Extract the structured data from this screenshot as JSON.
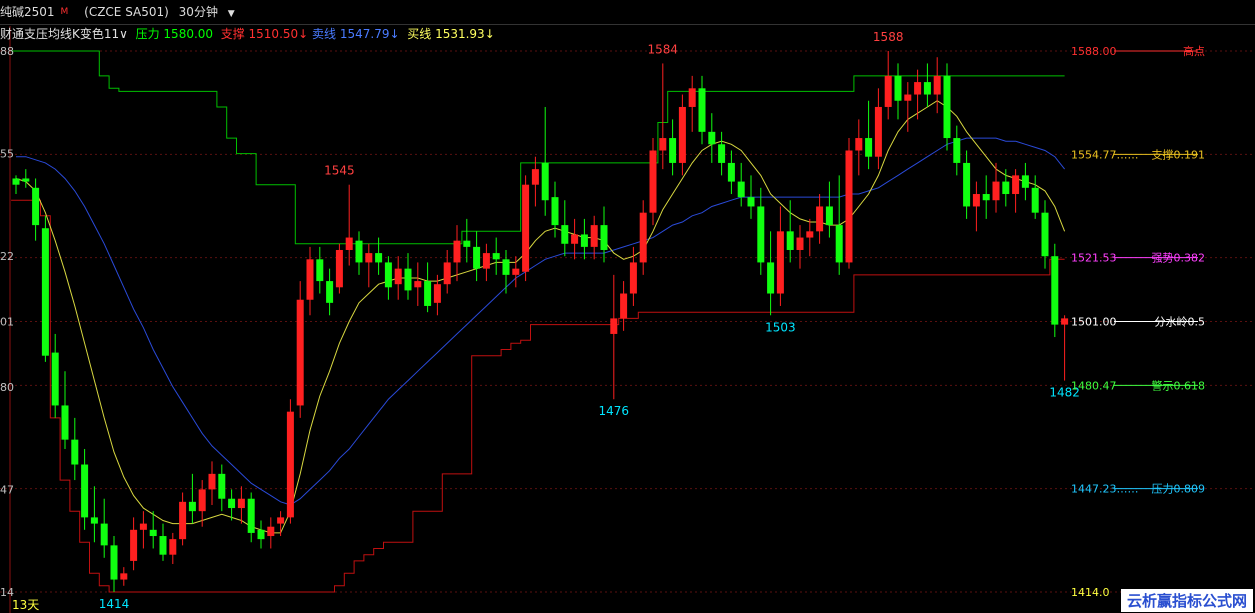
{
  "header": {
    "symbol": "纯碱2501",
    "marker": "M",
    "contract": "(CZCE SA501)",
    "period": "30分钟"
  },
  "indicator": {
    "name": "财通支压均线K变色11",
    "arrow": "∨",
    "resistance_label": "压力",
    "resistance_value": "1580.00",
    "support_label": "支撑",
    "support_value": "1510.50",
    "support_arrow": "↓",
    "sell_label": "卖线",
    "sell_value": "1547.79",
    "sell_arrow": "↓",
    "buy_label": "买线",
    "buy_value": "1531.93",
    "buy_arrow": "↓",
    "colors": {
      "name": "#e0e0e0",
      "resistance": "#00ff00",
      "support": "#ff3030",
      "sell": "#4a7bff",
      "buy": "#ffff60"
    }
  },
  "days_label": "13天",
  "watermark": "云析赢指标公式网",
  "chart_data": {
    "type": "candlestick",
    "y_axis_ticks": [
      {
        "value": 1588,
        "label": "88"
      },
      {
        "value": 1555,
        "label": "55"
      },
      {
        "value": 1522,
        "label": "22"
      },
      {
        "value": 1501,
        "label": "01"
      },
      {
        "value": 1480,
        "label": "80"
      },
      {
        "value": 1447,
        "label": "47"
      },
      {
        "value": 1414,
        "label": "14"
      }
    ],
    "ylim": [
      1411,
      1592
    ],
    "extreme_labels": [
      {
        "text": "1545",
        "value": 1545,
        "index": 33,
        "side": "high",
        "color": "#ff4040"
      },
      {
        "text": "1584",
        "value": 1584,
        "index": 66,
        "side": "high",
        "color": "#ff4040"
      },
      {
        "text": "1588",
        "value": 1588,
        "index": 89,
        "side": "high",
        "color": "#ff4040"
      },
      {
        "text": "1414",
        "value": 1414,
        "index": 10,
        "side": "low",
        "color": "#00e5ff"
      },
      {
        "text": "1476",
        "value": 1476,
        "index": 61,
        "side": "low",
        "color": "#00e5ff"
      },
      {
        "text": "1503",
        "value": 1503,
        "index": 78,
        "side": "low",
        "color": "#00e5ff"
      },
      {
        "text": "1482",
        "value": 1482,
        "index": 107,
        "side": "low",
        "color": "#00e5ff"
      }
    ],
    "levels": [
      {
        "value": 1588,
        "value_text": "1588.00",
        "name": "高点",
        "color": "#ff3030"
      },
      {
        "value": 1554.77,
        "value_text": "1554.77……",
        "name": "支撑0.191",
        "color": "#e8c020"
      },
      {
        "value": 1521.53,
        "value_text": "1521.53",
        "name": "强势0.382",
        "color": "#ff40ff"
      },
      {
        "value": 1501,
        "value_text": "1501.00",
        "name": "分水岭0.5",
        "color": "#ffffff"
      },
      {
        "value": 1480.47,
        "value_text": "1480.47",
        "name": "警示0.618",
        "color": "#40ff40"
      },
      {
        "value": 1447.23,
        "value_text": "1447.23……",
        "name": "压力0.809",
        "color": "#20c8ff"
      },
      {
        "value": 1414,
        "value_text": "1414.0",
        "name": "",
        "color": "#ffff40"
      }
    ],
    "candles": [
      [
        1547,
        1548,
        1542,
        1545
      ],
      [
        1547,
        1550,
        1544,
        1546
      ],
      [
        1544,
        1547,
        1527,
        1532
      ],
      [
        1531,
        1535,
        1488,
        1490
      ],
      [
        1491,
        1497,
        1470,
        1474
      ],
      [
        1474,
        1485,
        1460,
        1463
      ],
      [
        1463,
        1470,
        1450,
        1455
      ],
      [
        1455,
        1460,
        1434,
        1438
      ],
      [
        1438,
        1448,
        1430,
        1436
      ],
      [
        1436,
        1444,
        1425,
        1429
      ],
      [
        1429,
        1432,
        1414,
        1418
      ],
      [
        1418,
        1422,
        1416,
        1420
      ],
      [
        1424,
        1438,
        1421,
        1434
      ],
      [
        1434,
        1440,
        1428,
        1436
      ],
      [
        1434,
        1440,
        1428,
        1432
      ],
      [
        1432,
        1436,
        1424,
        1426
      ],
      [
        1426,
        1433,
        1423,
        1431
      ],
      [
        1431,
        1446,
        1429,
        1443
      ],
      [
        1443,
        1452,
        1436,
        1440
      ],
      [
        1440,
        1450,
        1435,
        1447
      ],
      [
        1447,
        1456,
        1442,
        1452
      ],
      [
        1452,
        1455,
        1440,
        1444
      ],
      [
        1444,
        1447,
        1437,
        1441
      ],
      [
        1441,
        1448,
        1436,
        1444
      ],
      [
        1444,
        1446,
        1430,
        1433
      ],
      [
        1434,
        1437,
        1428,
        1431
      ],
      [
        1432,
        1438,
        1428,
        1435
      ],
      [
        1436,
        1440,
        1432,
        1438
      ],
      [
        1438,
        1476,
        1436,
        1472
      ],
      [
        1474,
        1514,
        1470,
        1508
      ],
      [
        1508,
        1525,
        1503,
        1521
      ],
      [
        1521,
        1525,
        1510,
        1514
      ],
      [
        1514,
        1518,
        1503,
        1507
      ],
      [
        1512,
        1526,
        1510,
        1524
      ],
      [
        1524,
        1545,
        1519,
        1528
      ],
      [
        1527,
        1530,
        1516,
        1520
      ],
      [
        1520,
        1526,
        1512,
        1523
      ],
      [
        1523,
        1528,
        1516,
        1520
      ],
      [
        1520,
        1522,
        1508,
        1512
      ],
      [
        1513,
        1522,
        1508,
        1518
      ],
      [
        1518,
        1523,
        1508,
        1511
      ],
      [
        1512,
        1520,
        1506,
        1514
      ],
      [
        1514,
        1520,
        1504,
        1506
      ],
      [
        1507,
        1516,
        1503,
        1513
      ],
      [
        1513,
        1524,
        1510,
        1520
      ],
      [
        1520,
        1532,
        1514,
        1527
      ],
      [
        1527,
        1534,
        1520,
        1525
      ],
      [
        1525,
        1530,
        1514,
        1518
      ],
      [
        1518,
        1526,
        1514,
        1523
      ],
      [
        1523,
        1528,
        1516,
        1521
      ],
      [
        1521,
        1524,
        1510,
        1516
      ],
      [
        1516,
        1522,
        1512,
        1518
      ],
      [
        1517,
        1548,
        1514,
        1545
      ],
      [
        1545,
        1554,
        1538,
        1550
      ],
      [
        1552,
        1570,
        1535,
        1540
      ],
      [
        1541,
        1546,
        1528,
        1532
      ],
      [
        1532,
        1540,
        1522,
        1526
      ],
      [
        1526,
        1534,
        1521,
        1529
      ],
      [
        1529,
        1534,
        1521,
        1525
      ],
      [
        1525,
        1535,
        1521,
        1532
      ],
      [
        1532,
        1538,
        1520,
        1524
      ],
      [
        1497,
        1516,
        1476,
        1502
      ],
      [
        1502,
        1514,
        1498,
        1510
      ],
      [
        1510,
        1525,
        1506,
        1520
      ],
      [
        1520,
        1540,
        1516,
        1536
      ],
      [
        1536,
        1560,
        1532,
        1556
      ],
      [
        1556,
        1584,
        1550,
        1560
      ],
      [
        1560,
        1566,
        1548,
        1552
      ],
      [
        1552,
        1574,
        1548,
        1570
      ],
      [
        1570,
        1580,
        1562,
        1576
      ],
      [
        1576,
        1580,
        1558,
        1562
      ],
      [
        1562,
        1568,
        1552,
        1558
      ],
      [
        1558,
        1562,
        1548,
        1552
      ],
      [
        1552,
        1556,
        1542,
        1546
      ],
      [
        1546,
        1552,
        1538,
        1541
      ],
      [
        1541,
        1548,
        1534,
        1538
      ],
      [
        1538,
        1544,
        1516,
        1520
      ],
      [
        1520,
        1530,
        1503,
        1510
      ],
      [
        1510,
        1538,
        1506,
        1530
      ],
      [
        1530,
        1540,
        1520,
        1524
      ],
      [
        1524,
        1532,
        1518,
        1528
      ],
      [
        1528,
        1534,
        1522,
        1530
      ],
      [
        1530,
        1542,
        1526,
        1538
      ],
      [
        1538,
        1546,
        1528,
        1532
      ],
      [
        1532,
        1548,
        1516,
        1520
      ],
      [
        1520,
        1560,
        1518,
        1556
      ],
      [
        1556,
        1566,
        1548,
        1560
      ],
      [
        1560,
        1572,
        1550,
        1554
      ],
      [
        1554,
        1576,
        1550,
        1570
      ],
      [
        1570,
        1588,
        1566,
        1580
      ],
      [
        1580,
        1584,
        1566,
        1572
      ],
      [
        1572,
        1578,
        1562,
        1574
      ],
      [
        1574,
        1582,
        1566,
        1578
      ],
      [
        1578,
        1584,
        1570,
        1574
      ],
      [
        1574,
        1586,
        1568,
        1580
      ],
      [
        1580,
        1584,
        1556,
        1560
      ],
      [
        1560,
        1564,
        1548,
        1552
      ],
      [
        1552,
        1556,
        1534,
        1538
      ],
      [
        1538,
        1546,
        1530,
        1542
      ],
      [
        1542,
        1548,
        1534,
        1540
      ],
      [
        1540,
        1552,
        1536,
        1546
      ],
      [
        1546,
        1550,
        1538,
        1542
      ],
      [
        1542,
        1550,
        1536,
        1548
      ],
      [
        1548,
        1552,
        1540,
        1544
      ],
      [
        1544,
        1548,
        1534,
        1536
      ],
      [
        1536,
        1540,
        1518,
        1522
      ],
      [
        1522,
        1526,
        1496,
        1500
      ],
      [
        1500,
        1503,
        1482,
        1502
      ]
    ],
    "ma_slow": [
      1554,
      1554,
      1553,
      1552,
      1550,
      1547,
      1543,
      1538,
      1532,
      1526,
      1519,
      1512,
      1505,
      1499,
      1492,
      1486,
      1480,
      1475,
      1470,
      1465,
      1461,
      1458,
      1455,
      1452,
      1449,
      1447,
      1445,
      1443,
      1442,
      1444,
      1447,
      1450,
      1453,
      1457,
      1460,
      1464,
      1468,
      1472,
      1476,
      1479,
      1482,
      1485,
      1488,
      1491,
      1494,
      1497,
      1500,
      1503,
      1506,
      1509,
      1512,
      1515,
      1517,
      1519,
      1521,
      1522,
      1523,
      1523,
      1523,
      1523,
      1523,
      1524,
      1525,
      1526,
      1527,
      1528,
      1530,
      1532,
      1533,
      1535,
      1536,
      1538,
      1539,
      1540,
      1541,
      1541,
      1541,
      1541,
      1541,
      1541,
      1541,
      1541,
      1541,
      1541,
      1541,
      1542,
      1542,
      1543,
      1544,
      1546,
      1548,
      1550,
      1552,
      1554,
      1556,
      1558,
      1559,
      1560,
      1560,
      1560,
      1560,
      1559,
      1559,
      1558,
      1557,
      1556,
      1554,
      1550
    ],
    "ma_fast": [
      1547,
      1546,
      1543,
      1536,
      1527,
      1517,
      1506,
      1494,
      1482,
      1470,
      1459,
      1451,
      1445,
      1441,
      1439,
      1437,
      1436,
      1436,
      1436,
      1437,
      1438,
      1439,
      1438,
      1437,
      1435,
      1434,
      1433,
      1433,
      1440,
      1452,
      1466,
      1477,
      1485,
      1494,
      1501,
      1507,
      1510,
      1513,
      1514,
      1515,
      1515,
      1515,
      1514,
      1514,
      1515,
      1516,
      1517,
      1518,
      1519,
      1520,
      1520,
      1520,
      1523,
      1527,
      1530,
      1531,
      1530,
      1529,
      1528,
      1528,
      1527,
      1523,
      1521,
      1522,
      1524,
      1530,
      1537,
      1542,
      1547,
      1552,
      1556,
      1558,
      1559,
      1558,
      1556,
      1552,
      1548,
      1542,
      1539,
      1536,
      1534,
      1533,
      1533,
      1532,
      1532,
      1534,
      1538,
      1542,
      1548,
      1556,
      1562,
      1566,
      1568,
      1570,
      1572,
      1570,
      1567,
      1562,
      1558,
      1554,
      1550,
      1548,
      1547,
      1546,
      1545,
      1543,
      1538,
      1530
    ],
    "resistance_line": [
      1588,
      1588,
      1588,
      1588,
      1588,
      1588,
      1588,
      1588,
      1588,
      1580,
      1576,
      1575,
      1575,
      1575,
      1575,
      1575,
      1575,
      1575,
      1575,
      1575,
      1575,
      1570,
      1560,
      1555,
      1555,
      1545,
      1545,
      1545,
      1545,
      1526,
      1526,
      1526,
      1526,
      1526,
      1526,
      1526,
      1526,
      1526,
      1526,
      1526,
      1526,
      1526,
      1526,
      1526,
      1526,
      1526,
      1530,
      1530,
      1530,
      1530,
      1530,
      1530,
      1552,
      1552,
      1552,
      1552,
      1552,
      1552,
      1552,
      1552,
      1552,
      1552,
      1552,
      1552,
      1552,
      1552,
      1565,
      1575,
      1575,
      1575,
      1575,
      1575,
      1575,
      1575,
      1575,
      1575,
      1575,
      1575,
      1575,
      1575,
      1575,
      1575,
      1575,
      1575,
      1575,
      1575,
      1580,
      1580,
      1580,
      1580,
      1580,
      1580,
      1580,
      1580,
      1580,
      1580,
      1580,
      1580,
      1580,
      1580,
      1580,
      1580,
      1580,
      1580,
      1580,
      1580,
      1580,
      1580
    ],
    "support_line": [
      1540,
      1540,
      1540,
      1535,
      1470,
      1450,
      1440,
      1430,
      1420,
      1416,
      1414,
      1414,
      1414,
      1414,
      1414,
      1414,
      1414,
      1414,
      1414,
      1414,
      1414,
      1414,
      1414,
      1414,
      1414,
      1414,
      1414,
      1414,
      1414,
      1414,
      1414,
      1414,
      1414,
      1416,
      1420,
      1424,
      1426,
      1428,
      1430,
      1430,
      1430,
      1440,
      1440,
      1440,
      1452,
      1452,
      1452,
      1490,
      1490,
      1490,
      1492,
      1494,
      1495,
      1500,
      1500,
      1500,
      1500,
      1500,
      1500,
      1500,
      1500,
      1500,
      1502,
      1502,
      1504,
      1504,
      1504,
      1504,
      1504,
      1504,
      1504,
      1504,
      1504,
      1504,
      1504,
      1504,
      1504,
      1504,
      1504,
      1504,
      1504,
      1504,
      1504,
      1504,
      1504,
      1504,
      1516,
      1516,
      1516,
      1516,
      1516,
      1516,
      1516,
      1516,
      1516,
      1516,
      1516,
      1516,
      1516,
      1516,
      1516,
      1516,
      1516,
      1516,
      1516,
      1516,
      1521,
      1521
    ]
  }
}
